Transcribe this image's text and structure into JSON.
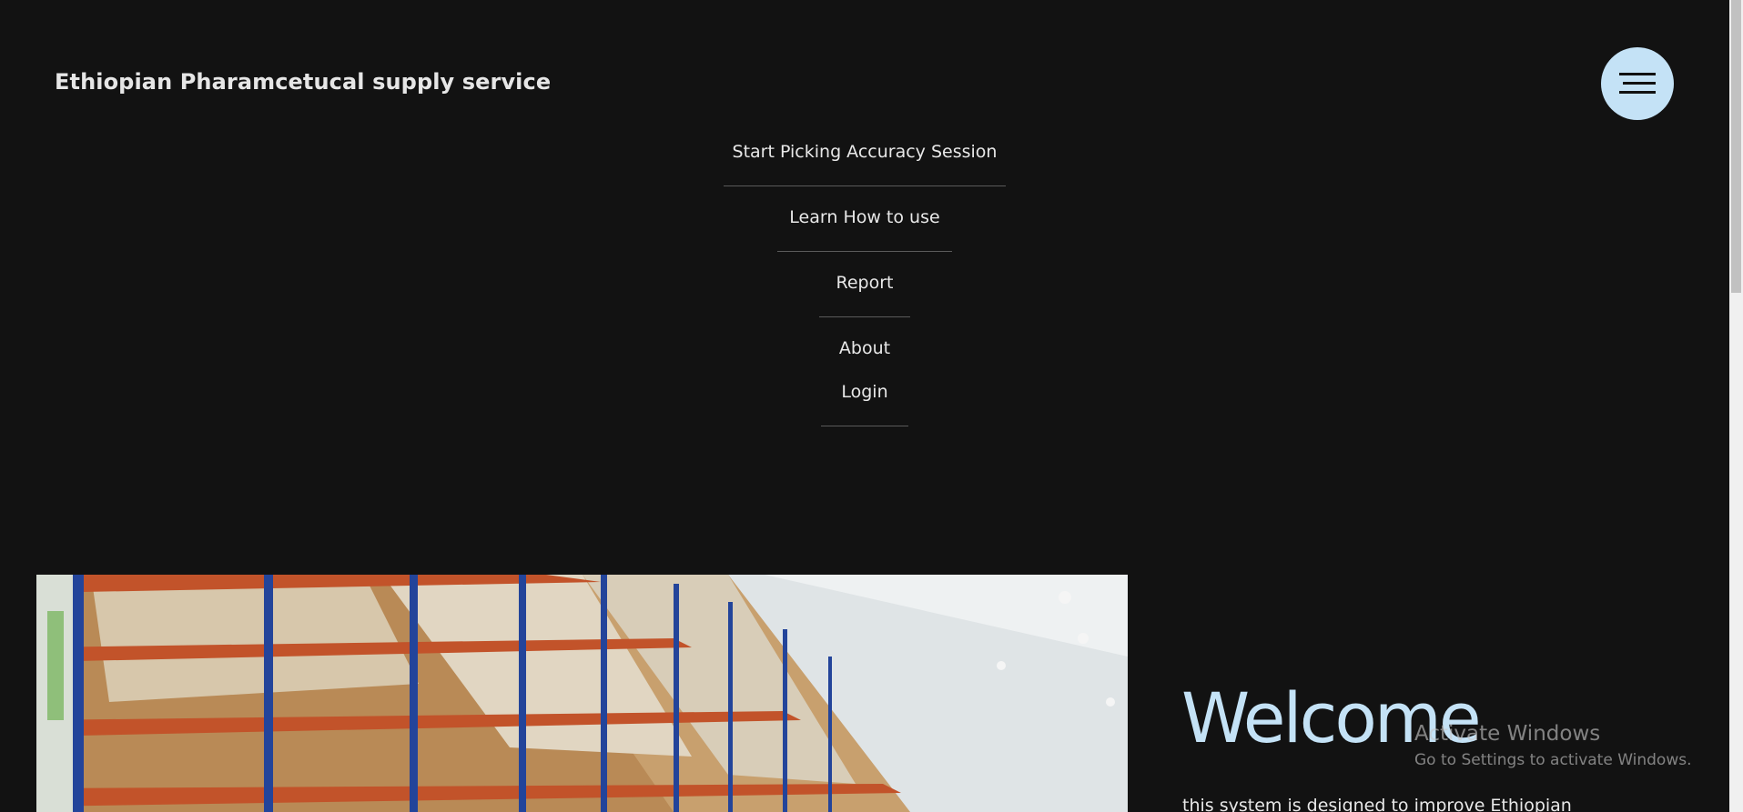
{
  "header": {
    "brand": "Ethiopian Pharamcetucal supply service",
    "menu_icon": "hamburger-menu-icon"
  },
  "nav": {
    "items": [
      {
        "label": "Start Picking Accuracy Session"
      },
      {
        "label": "Learn How to use"
      },
      {
        "label": "Report"
      },
      {
        "label": "About"
      },
      {
        "label": "Login"
      }
    ]
  },
  "hero": {
    "image_subject": "warehouse-shelves-image",
    "welcome": "Welcome",
    "intro": "this system is designed to improve Ethiopian"
  },
  "os_overlay": {
    "title": "Activate Windows",
    "subtitle": "Go to Settings to activate Windows."
  },
  "colors": {
    "background": "#121212",
    "accent": "#c4e2f6",
    "text": "#e8e8e8",
    "divider": "#5a5a5a"
  }
}
